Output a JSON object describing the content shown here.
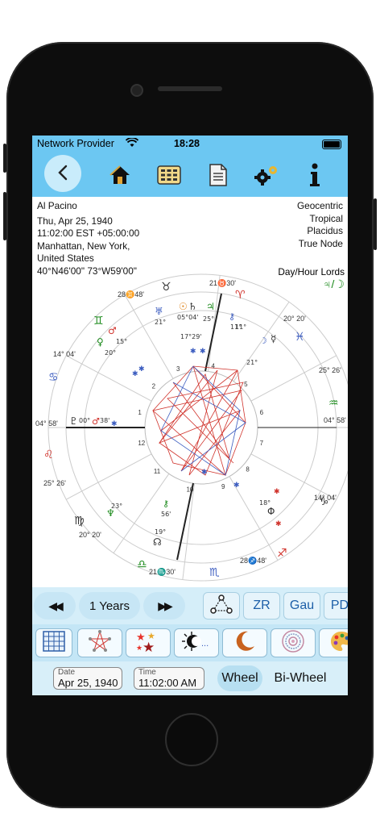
{
  "status_bar": {
    "carrier": "Network Provider",
    "time": "18:28"
  },
  "toolbar": {
    "icons": [
      "back-icon",
      "home-icon",
      "calendar-grid-icon",
      "document-icon",
      "settings-gears-icon",
      "info-icon"
    ]
  },
  "chart_info": {
    "name": "Al Pacino",
    "date": "Thu, Apr 25, 1940",
    "time_zone": "11:02:00 EST +05:00:00",
    "place_line1": "Manhattan, New York,",
    "place_line2": "United States",
    "coords": "40°N46'00\" 73°W59'00\"",
    "settings": [
      "Geocentric",
      "Tropical",
      "Placidus",
      "True Node"
    ],
    "lords_label": "Day/Hour Lords",
    "lords_value": "♃/☽"
  },
  "wheel": {
    "cusp_labels": {
      "mc": "21♉30'",
      "ic": "21♏30'",
      "asc": "04° 58'",
      "dsc": "04° 58'",
      "c11": "28♊48'",
      "c12": "14° 04'",
      "c2": "25° 26'",
      "c3": "20° 20'",
      "c5": "28♐48'",
      "c6": "14° 04'",
      "c8": "25° 26'",
      "c9": "20° 20'"
    },
    "sign_glyphs": [
      "♈",
      "♉",
      "♊",
      "♋",
      "♌",
      "♍",
      "♎",
      "♏",
      "♐",
      "♑",
      "♒",
      "♓"
    ],
    "house_numbers": [
      "1",
      "2",
      "3",
      "4",
      "5",
      "6",
      "7",
      "8",
      "9",
      "10",
      "11",
      "12"
    ],
    "planet_labels": [
      {
        "g": "♅",
        "t": "21°"
      },
      {
        "g": "♂",
        "t": "15°"
      },
      {
        "g": "♀",
        "t": "20°"
      },
      {
        "g": "☉",
        "t": "05°04'"
      },
      {
        "g": "♄",
        "t": "17°29'"
      },
      {
        "g": "♃",
        "t": "25°"
      },
      {
        "g": "♆",
        "t": "23°"
      },
      {
        "g": "☊",
        "t": "19°"
      },
      {
        "g": "⚷",
        "t": "11°"
      },
      {
        "g": "☽",
        "t": "21°"
      },
      {
        "g": "☿",
        "t": "11°"
      },
      {
        "g": "♇",
        "t": "00°"
      },
      {
        "g": "♂",
        "t": "38'"
      },
      {
        "g": "⚷",
        "t": "56'"
      },
      {
        "g": "Φ",
        "t": "18°"
      }
    ],
    "colors": {
      "red": "#d0322b",
      "blue": "#3a5bbf",
      "green": "#1b8a1b",
      "orange": "#e0851e"
    }
  },
  "nav": {
    "rewind": "◀◀",
    "step": "1 Years",
    "forward": "▶▶",
    "aspect_pattern_icon": "aspect-pattern-icon",
    "zr": "ZR",
    "gau": "Gau",
    "pd": "PD"
  },
  "tools": [
    "grid-icon",
    "aspect-star-icon",
    "stars-icon",
    "eclipse-icon",
    "moon-phase-icon",
    "mandala-icon",
    "palette-icon"
  ],
  "bottom": {
    "date_label": "Date",
    "date_value": "Apr 25, 1940",
    "time_label": "Time",
    "time_value": "11:02:00 AM",
    "wheel": "Wheel",
    "bi_wheel": "Bi-Wheel"
  }
}
